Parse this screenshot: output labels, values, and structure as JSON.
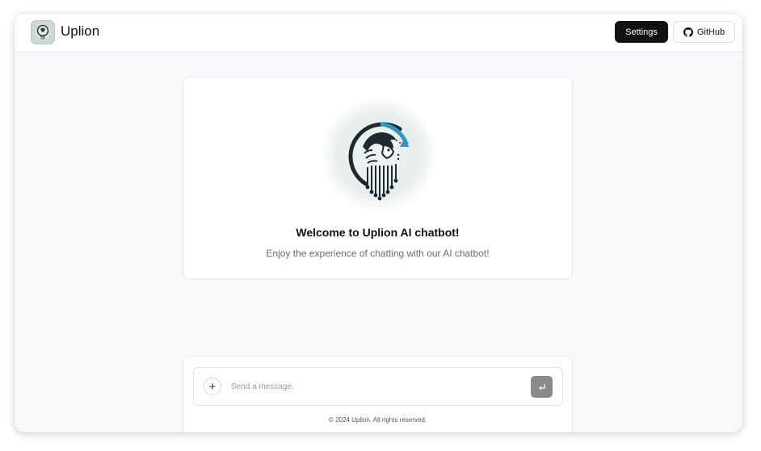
{
  "header": {
    "app_title": "Uplion",
    "settings_label": "Settings",
    "github_label": "GitHub"
  },
  "welcome": {
    "title": "Welcome to Uplion AI chatbot!",
    "subtitle": "Enjoy the experience of chatting with our AI chatbot!"
  },
  "composer": {
    "placeholder": "Send a message.",
    "value": ""
  },
  "footer": {
    "text": "© 2024 Uplion. All rights reserved."
  },
  "icons": {
    "logo": "lion-circuit-logo",
    "plus": "plus-icon",
    "send": "enter-icon",
    "github": "github-icon"
  },
  "colors": {
    "primary_button": "#111113",
    "send_button": "#8a8a8c",
    "logo_accent": "#2a9bc4",
    "logo_dark": "#1e2a30"
  }
}
